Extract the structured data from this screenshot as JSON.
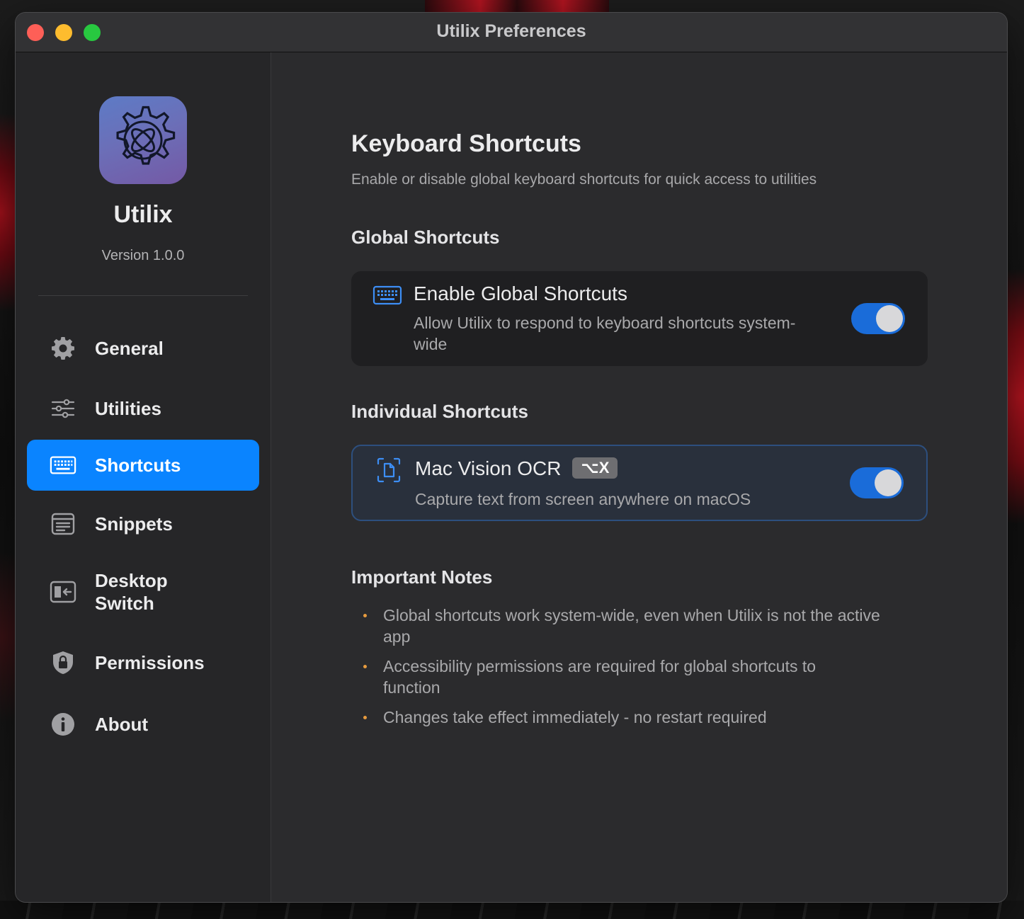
{
  "window": {
    "title": "Utilix Preferences"
  },
  "sidebar": {
    "app_name": "Utilix",
    "version": "Version 1.0.0",
    "items": [
      {
        "label": "General",
        "icon": "gear-icon",
        "active": false
      },
      {
        "label": "Utilities",
        "icon": "sliders-icon",
        "active": false
      },
      {
        "label": "Shortcuts",
        "icon": "keyboard-icon",
        "active": true
      },
      {
        "label": "Snippets",
        "icon": "document-icon",
        "active": false
      },
      {
        "label": "Desktop Switch",
        "icon": "desktop-switch-icon",
        "active": false
      },
      {
        "label": "Permissions",
        "icon": "shield-lock-icon",
        "active": false
      },
      {
        "label": "About",
        "icon": "info-icon",
        "active": false
      }
    ]
  },
  "main": {
    "title": "Keyboard Shortcuts",
    "subtitle": "Enable or disable global keyboard shortcuts for quick access to utilities",
    "global_section": {
      "title": "Global Shortcuts",
      "card": {
        "icon": "keyboard-icon",
        "title": "Enable Global Shortcuts",
        "description": "Allow Utilix to respond to keyboard shortcuts system-wide",
        "enabled": true
      }
    },
    "individual_section": {
      "title": "Individual Shortcuts",
      "card": {
        "icon": "text-scan-icon",
        "title": "Mac Vision OCR",
        "shortcut": "⌥X",
        "description": "Capture text from screen anywhere on macOS",
        "enabled": true
      }
    },
    "notes_section": {
      "title": "Important Notes",
      "items": [
        "Global shortcuts work system-wide, even when Utilix is not the active app",
        "Accessibility permissions are required for global shortcuts to function",
        "Changes take effect immediately - no restart required"
      ]
    }
  },
  "colors": {
    "accent": "#0a84ff",
    "toggle_on": "#1a6cd9",
    "bullet": "#e79b3e"
  }
}
